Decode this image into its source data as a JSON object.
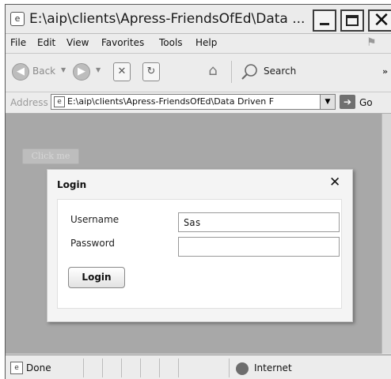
{
  "window": {
    "title": "E:\\aip\\clients\\Apress-FriendsOfEd\\Data ...",
    "icon": "ie-page-icon",
    "controls": {
      "minimize": "minimize-icon",
      "maximize": "maximize-icon",
      "close": "✕"
    }
  },
  "menu": {
    "items": [
      "File",
      "Edit",
      "View",
      "Favorites",
      "Tools",
      "Help"
    ],
    "logo": "windows-logo-icon"
  },
  "toolbar": {
    "back_label": "Back",
    "search_label": "Search",
    "more": "»",
    "icons": [
      "back-arrow-icon",
      "forward-arrow-icon",
      "stop-icon",
      "refresh-icon",
      "home-icon",
      "search-icon"
    ]
  },
  "address": {
    "label": "Address",
    "value": "E:\\aip\\clients\\Apress-FriendsOfEd\\Data Driven F",
    "go_label": "Go"
  },
  "page": {
    "click_button_label": "Click me",
    "dialog": {
      "title": "Login",
      "close": "✕",
      "username_label": "Username",
      "username_value": "Sas",
      "password_label": "Password",
      "password_value": "",
      "login_button_label": "Login"
    }
  },
  "status": {
    "text": "Done",
    "zone": "Internet"
  },
  "colors": {
    "content_background": "#a8a8a8",
    "dialog_background": "#f4f4f4",
    "chrome": "#ececec"
  }
}
